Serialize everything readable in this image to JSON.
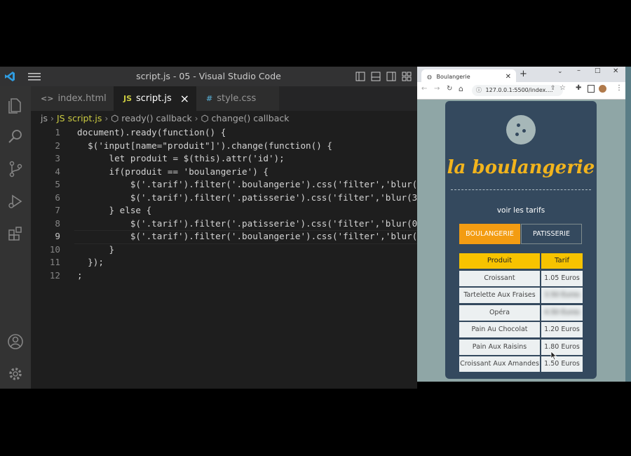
{
  "vscode": {
    "title": "script.js - 05 - Visual Studio Code",
    "tabs": [
      {
        "icon": "<>",
        "label": "index.html"
      },
      {
        "icon": "JS",
        "label": "script.js",
        "close": "×"
      },
      {
        "icon": "#",
        "label": "style.css"
      }
    ],
    "breadcrumb": [
      "js",
      "JS script.js",
      "ready() callback",
      "change() callback"
    ],
    "line_numbers": [
      "1",
      "2",
      "3",
      "4",
      "5",
      "6",
      "7",
      "8",
      "9",
      "10",
      "11",
      "12"
    ],
    "current_line": "9",
    "code_lines": [
      "document).ready(function() {",
      "  $('input[name=\"produit\"]').change(function() {",
      "      let produit = $(this).attr('id');",
      "      if(produit == 'boulangerie') {",
      "          $('.tarif').filter('.boulangerie').css('filter','blur(0",
      "          $('.tarif').filter('.patisserie').css('filter','blur(3p",
      "      } else {",
      "          $('.tarif').filter('.patisserie').css('filter','blur(0)",
      "          $('.tarif').filter('.boulangerie').css('filter','blur(3",
      "      }",
      "  });",
      ";"
    ]
  },
  "browser": {
    "tab_title": "Boulangerie",
    "url": "127.0.0.1:5500/index....",
    "page": {
      "brand": "la boulangerie",
      "subtitle": "voir les tarifs",
      "buttons": [
        "BOULANGERIE",
        "PATISSERIE"
      ],
      "table_headers": [
        "Produit",
        "Tarif"
      ],
      "rows": [
        {
          "produit": "Croissant",
          "tarif": "1.05 Euros"
        },
        {
          "produit": "Tartelette Aux Fraises",
          "tarif": "3.50 Euros"
        },
        {
          "produit": "Opéra",
          "tarif": "4.50 Euros"
        },
        {
          "produit": "Pain Au Chocolat",
          "tarif": "1.20 Euros"
        },
        {
          "produit": "Pain Aux Raisins",
          "tarif": "1.80 Euros"
        },
        {
          "produit": "Croissant Aux Amandes",
          "tarif": "1.50 Euros"
        }
      ]
    }
  },
  "colors": {
    "accent": "#f2b41d",
    "card": "#34495e",
    "header_yellow": "#f7c300"
  }
}
